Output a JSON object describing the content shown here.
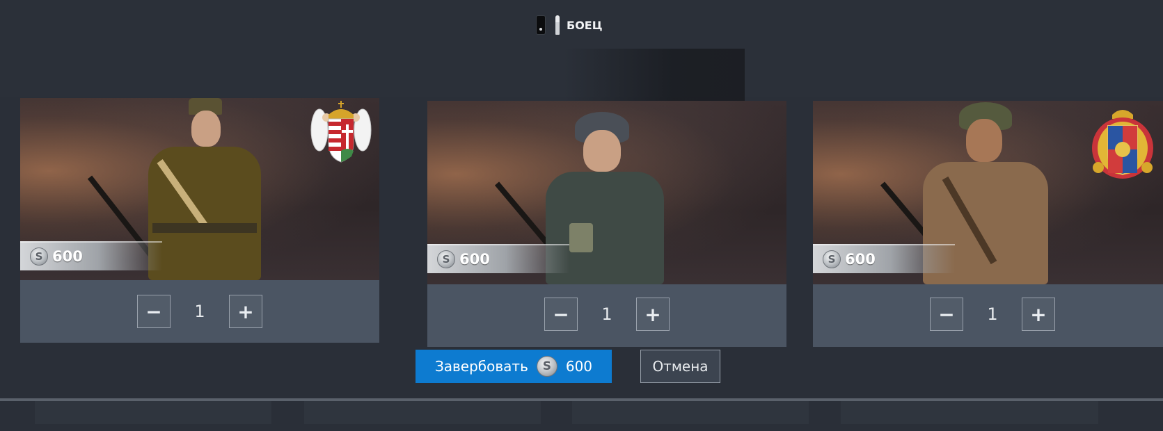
{
  "header": {
    "rank_label": "БОЕЦ",
    "rank_icon": "private-rank-icon",
    "ammo_icon": "bullet-icon"
  },
  "cards": [
    {
      "price": "600",
      "quantity": "1",
      "minus": "−",
      "plus": "+",
      "emblem": "hungary-coat-of-arms"
    },
    {
      "price": "600",
      "quantity": "1",
      "minus": "−",
      "plus": "+",
      "emblem": ""
    },
    {
      "price": "600",
      "quantity": "1",
      "minus": "−",
      "plus": "+",
      "emblem": "romania-coat-of-arms"
    }
  ],
  "currency_symbol": "S",
  "actions": {
    "recruit_label": "Завербовать",
    "recruit_price": "600",
    "cancel_label": "Отмена"
  },
  "colors": {
    "accent": "#0d7bd0",
    "card_bg": "#4b5563",
    "page_bg": "#2a2f38"
  }
}
